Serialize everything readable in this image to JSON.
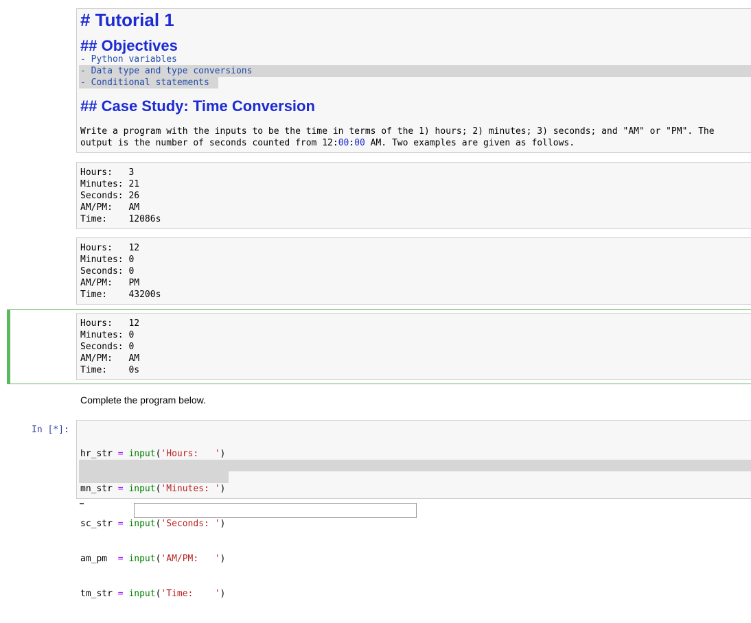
{
  "markdown": {
    "h1": "# Tutorial 1",
    "h2_objectives": "## Objectives",
    "objectives": [
      "- Python variables",
      "- Data type and type conversions",
      "- Conditional statements"
    ],
    "h2_case": "## Case Study: Time Conversion",
    "desc_line1": "Write a program with the inputs to be the time in terms of the 1) hours; 2) minutes; 3) seconds; and \"AM\" or \"PM\". The",
    "desc_line2_pre": "output is the number of seconds counted from 12:",
    "desc_line2_num1": "00",
    "desc_line2_mid": ":",
    "desc_line2_num2": "00",
    "desc_line2_post": " AM. Two examples are given as follows."
  },
  "examples": [
    {
      "lines": [
        "Hours:   3",
        "Minutes: 21",
        "Seconds: 26",
        "AM/PM:   AM",
        "Time:    12086s"
      ]
    },
    {
      "lines": [
        "Hours:   12",
        "Minutes: 0",
        "Seconds: 0",
        "AM/PM:   PM",
        "Time:    43200s"
      ]
    },
    {
      "lines": [
        "Hours:   12",
        "Minutes: 0",
        "Seconds: 0",
        "AM/PM:   AM",
        "Time:    0s"
      ]
    }
  ],
  "instruction": "Complete the program below.",
  "code_cell": {
    "prompt": "In [*]:",
    "lines": [
      {
        "var": "hr_str",
        "op": " = ",
        "fn": "input",
        "open": "(",
        "str": "'Hours:   '",
        "close": ")"
      },
      {
        "var": "mn_str",
        "op": " = ",
        "fn": "input",
        "open": "(",
        "str": "'Minutes: '",
        "close": ")"
      },
      {
        "var": "sc_str",
        "op": " = ",
        "fn": "input",
        "open": "(",
        "str": "'Seconds: '",
        "close": ")"
      },
      {
        "var": "am_pm ",
        "op": " = ",
        "fn": "input",
        "open": "(",
        "str": "'AM/PM:   '",
        "close": ")"
      },
      {
        "var": "tm_str",
        "op": " = ",
        "fn": "input",
        "open": "(",
        "str": "'Time:    '",
        "close": ")"
      }
    ]
  },
  "colors": {
    "heading": "#1c2bd4",
    "list_text": "#1f4aa8",
    "selected_cell": "#5cb85c",
    "prompt": "#303f9f"
  }
}
